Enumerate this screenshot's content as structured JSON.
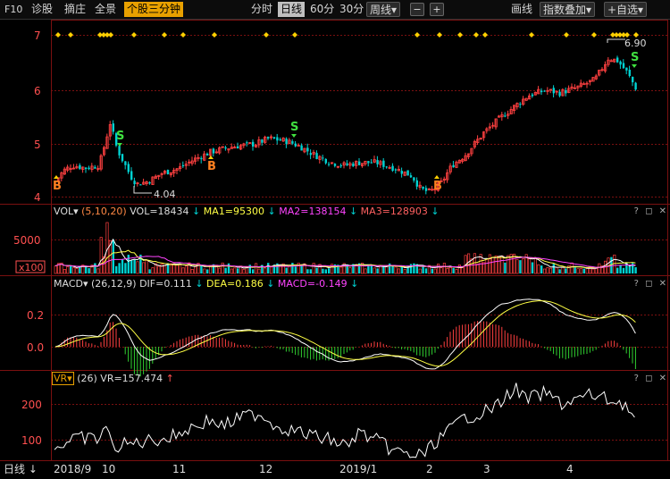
{
  "topbar": {
    "f10": "F10",
    "diagnose": "诊股",
    "pick": "摘庄",
    "panorama": "全景",
    "stock3min": "个股三分钟",
    "tabs": [
      "分时",
      "日线",
      "60分",
      "30分"
    ],
    "period_dropdown": "周线▾",
    "draw_line": "画线",
    "index_overlay": "指数叠加▾",
    "add_watch": "+自选▾"
  },
  "main_chart": {
    "y_ticks": [
      "7",
      "6",
      "5",
      "4"
    ],
    "high_label": "6.90",
    "low_label": "4.04",
    "buy_marker": "B",
    "sell_marker": "S"
  },
  "vol": {
    "name": "VOL▾",
    "params": "(5,10,20)",
    "vol": "VOL=18434",
    "ma1": "MA1=95300",
    "ma2": "MA2=138154",
    "ma3": "MA3=128903",
    "y_tick": "5000",
    "unit": "x100"
  },
  "macd": {
    "name": "MACD▾",
    "params": "(26,12,9)",
    "dif": "DIF=0.111",
    "dea": "DEA=0.186",
    "macd": "MACD=-0.149",
    "y_ticks": [
      "0.2",
      "0.0"
    ]
  },
  "vr": {
    "name": "VR▾",
    "params": "(26)",
    "value": "VR=157.474",
    "y_ticks": [
      "200",
      "100"
    ]
  },
  "timeline": {
    "label": "日线",
    "months": [
      "2018/9",
      "10",
      "11",
      "12",
      "2019/1",
      "2",
      "3",
      "4"
    ]
  },
  "panel_controls": "? ◻ ✕",
  "colors": {
    "up": "#ff4040",
    "down": "#00d2d2",
    "grid": "#7a1010",
    "signal": "#ffff00",
    "accent": "#e8a000"
  }
}
